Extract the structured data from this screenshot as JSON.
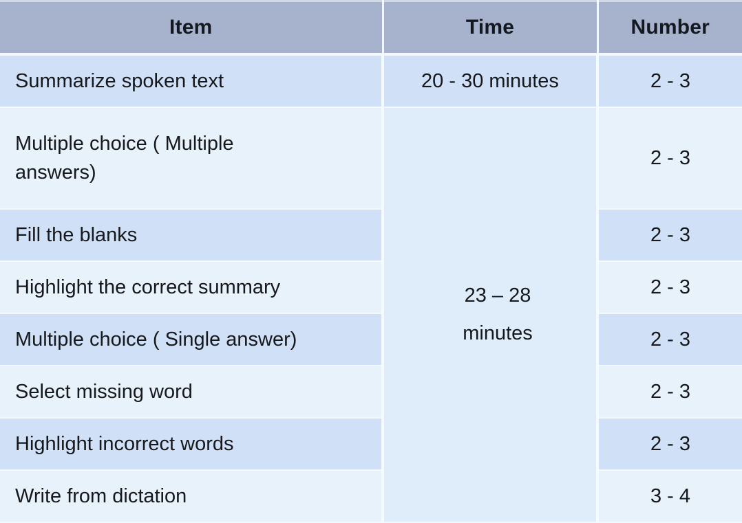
{
  "table": {
    "columns": [
      {
        "key": "item",
        "label": "Item"
      },
      {
        "key": "time",
        "label": "Time"
      },
      {
        "key": "number",
        "label": "Number"
      }
    ],
    "rows": [
      {
        "item": "Summarize spoken text",
        "item_line1": "Summarize spoken text",
        "item_line2": "",
        "time": "20 - 30 minutes",
        "number": "2 - 3"
      },
      {
        "item": "Multiple choice ( Multiple answers)",
        "item_line1": "Multiple choice ( Multiple",
        "item_line2": "answers)",
        "time": "",
        "number": "2 - 3"
      },
      {
        "item": "Fill the blanks",
        "item_line1": "Fill the blanks",
        "item_line2": "",
        "time": "",
        "number": "2 - 3"
      },
      {
        "item": "Highlight the correct summary",
        "item_line1": "Highlight the correct summary",
        "item_line2": "",
        "time": "",
        "number": "2 - 3"
      },
      {
        "item": "Multiple choice ( Single answer)",
        "item_line1": "Multiple choice ( Single answer)",
        "item_line2": "",
        "time": "",
        "number": "2 - 3"
      },
      {
        "item": "Select missing word",
        "item_line1": "Select missing word",
        "item_line2": "",
        "time": "",
        "number": "2 - 3"
      },
      {
        "item": "Highlight incorrect words",
        "item_line1": "Highlight incorrect words",
        "item_line2": "",
        "time": "",
        "number": "2 - 3"
      },
      {
        "item": "Write from dictation",
        "item_line1": "Write from dictation",
        "item_line2": "",
        "time": "",
        "number": "3 - 4"
      }
    ],
    "merged_time_cell": {
      "line1": "23 – 28",
      "line2": "minutes",
      "spans_rows": "2-8"
    }
  },
  "colors": {
    "header_background": "#a7b2cc",
    "header_text": "#141820",
    "row_band_dark": "#cfe0f7",
    "row_band_light": "#e3eefb",
    "row_band_pale": "#e8f2fb",
    "merged_time_background": "#dfecfa",
    "grid_line": "#f4fafe",
    "body_text": "#16181c"
  }
}
